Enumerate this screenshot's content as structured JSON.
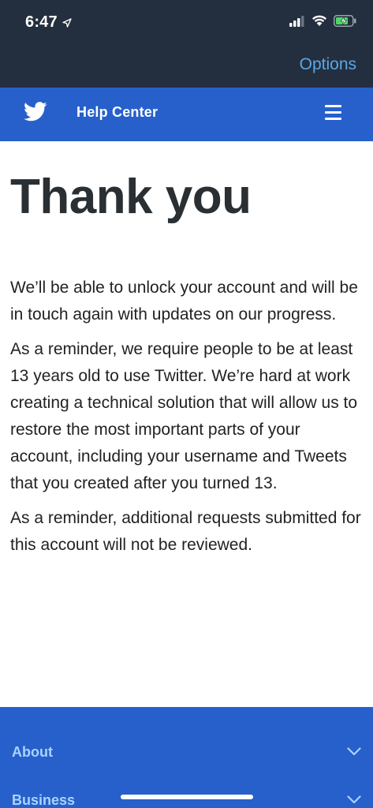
{
  "status_bar": {
    "time": "6:47"
  },
  "browser": {
    "options_label": "Options"
  },
  "header": {
    "title": "Help Center",
    "brand_color": "#2760cb"
  },
  "main": {
    "title": "Thank you",
    "paragraphs": [
      "We’ll be able to unlock your account and will be in touch again with updates on our progress.",
      "As a reminder, we require people to be at least 13 years old to use Twitter. We’re hard at work creating a technical solution that will allow us to restore the most important parts of your account, including your username and Tweets that you created after you turned 13.",
      "As a reminder, additional requests submitted for this account will not be reviewed."
    ]
  },
  "footer": {
    "items": [
      {
        "label": "About"
      },
      {
        "label": "Business"
      }
    ]
  }
}
